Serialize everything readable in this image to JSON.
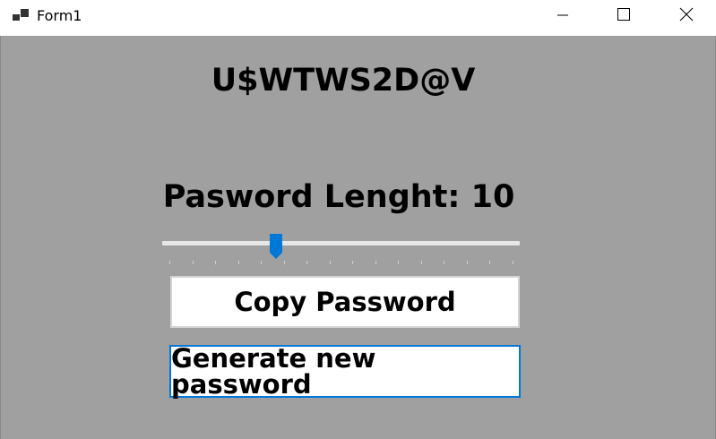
{
  "window": {
    "title": "Form1",
    "controls": {
      "minimize": "minimize-icon",
      "maximize": "maximize-icon",
      "close": "close-icon"
    }
  },
  "form": {
    "generated_password": "U$WTWS2D@V",
    "length_label": "Pasword Lenght: 10",
    "slider": {
      "value": 10,
      "min": 1,
      "max": 30,
      "tick_count": 16,
      "accent_color": "#0078d7"
    },
    "copy_button_label": "Copy Password",
    "generate_button_label": "Generate new password",
    "background_color": "#a0a0a0",
    "focused_button_border_color": "#0078d7"
  }
}
